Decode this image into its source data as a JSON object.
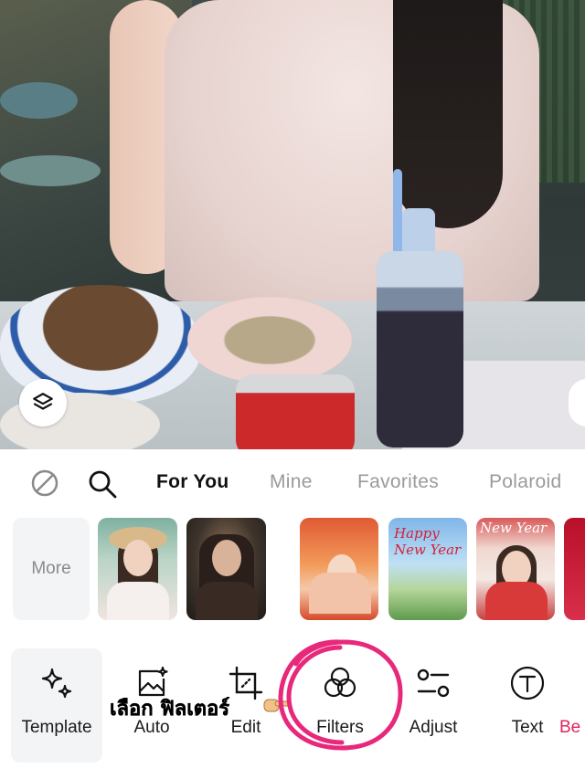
{
  "photo": {},
  "category_tabs": [
    {
      "label": "For You",
      "active": true
    },
    {
      "label": "Mine",
      "active": false
    },
    {
      "label": "Favorites",
      "active": false
    },
    {
      "label": "Polaroid",
      "active": false
    }
  ],
  "filters": {
    "more_label": "More",
    "thumb4_text": "Happy New Year",
    "thumb5_text": "New Year"
  },
  "annotation": {
    "text": "เลือก ฟิลเตอร์",
    "highlight_color": "#e8287a"
  },
  "tools": [
    {
      "label": "Template",
      "icon": "sparkle-icon",
      "selected": true
    },
    {
      "label": "Auto",
      "icon": "auto-enhance-icon"
    },
    {
      "label": "Edit",
      "icon": "crop-icon"
    },
    {
      "label": "Filters",
      "icon": "filters-icon"
    },
    {
      "label": "Adjust",
      "icon": "adjust-sliders-icon"
    },
    {
      "label": "Text",
      "icon": "text-icon"
    },
    {
      "label": "Be",
      "icon": "beauty-icon",
      "color": "#e0245e"
    }
  ]
}
